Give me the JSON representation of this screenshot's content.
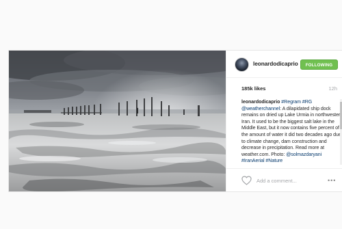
{
  "post": {
    "username": "leonardodicaprio",
    "follow_label": "FOLLOWING",
    "likes": "185k likes",
    "time": "12h",
    "caption": {
      "username": "leonardodicaprio",
      "tags": "#Regram #RG",
      "mention": "@weatherchannel",
      "text": ": A dilapidated ship dock remains on dried up Lake Urmia in northwestern Iran. It used to be the biggest salt lake in the Middle East, but it now contains five percent of the amount of water it did two decades ago due to climate change, dam construction and decrease in precipitation. Read more at weather.com. Photo: ",
      "photo_credit": "@solmazdaryani",
      "trailing_tags": "#IranAerial #Nature"
    },
    "comment_placeholder": "Add a comment...",
    "icons": {
      "heart": "heart-icon",
      "more": "more-options-icon"
    },
    "colors": {
      "follow_button": "#70c050",
      "link": "#003569"
    }
  }
}
